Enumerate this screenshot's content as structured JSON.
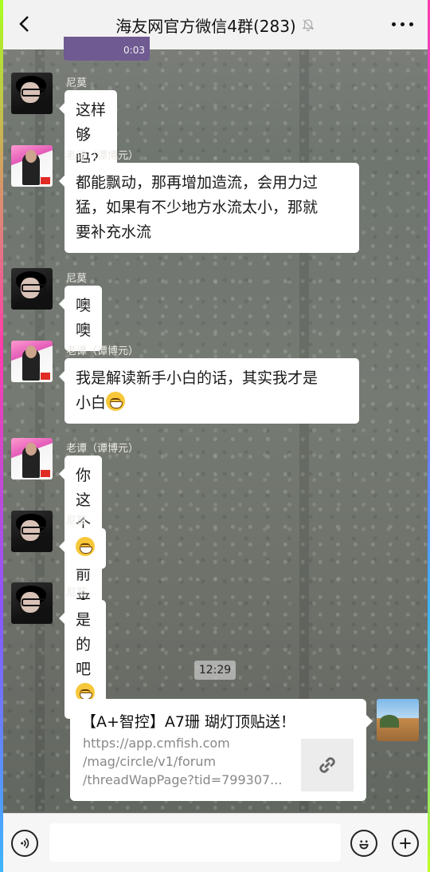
{
  "header": {
    "title": "海友网官方微信4群(283)"
  },
  "previous_media": {
    "duration": "0:03"
  },
  "messages": [
    {
      "sender": "尼莫",
      "text": "这样够吗？",
      "emoji": false
    },
    {
      "sender": "老谭（谭博元）",
      "lines": [
        "都能飘动，那再增加造流，会用力过",
        "猛，如果有不少地方水流太小，那就",
        "要补充水流"
      ]
    },
    {
      "sender": "尼莫",
      "text": "噢噢"
    },
    {
      "sender": "老谭（谭博元）",
      "lines": [
        "我是解读新手小白的话，其实我才是",
        "小白"
      ]
    },
    {
      "sender": "老谭（谭博元）",
      "text": "你这个目前来看挺好呀"
    },
    {
      "sender": "尼莫",
      "text": ""
    },
    {
      "sender": "尼莫",
      "text": "是的吧"
    }
  ],
  "timestamp": "12:29",
  "link_card": {
    "title": "【A+智控】A7珊 瑚灯顶贴送！",
    "url_lines": [
      "https://app.cmfish.com",
      "/mag/circle/v1/forum",
      "/threadWapPage?tid=799307..."
    ]
  },
  "icons": {
    "back": "back-icon",
    "mute": "mute-bell-icon",
    "more": "more-icon",
    "voice": "voice-icon",
    "emoji": "emoji-icon",
    "plus": "plus-icon",
    "link": "link-icon"
  }
}
